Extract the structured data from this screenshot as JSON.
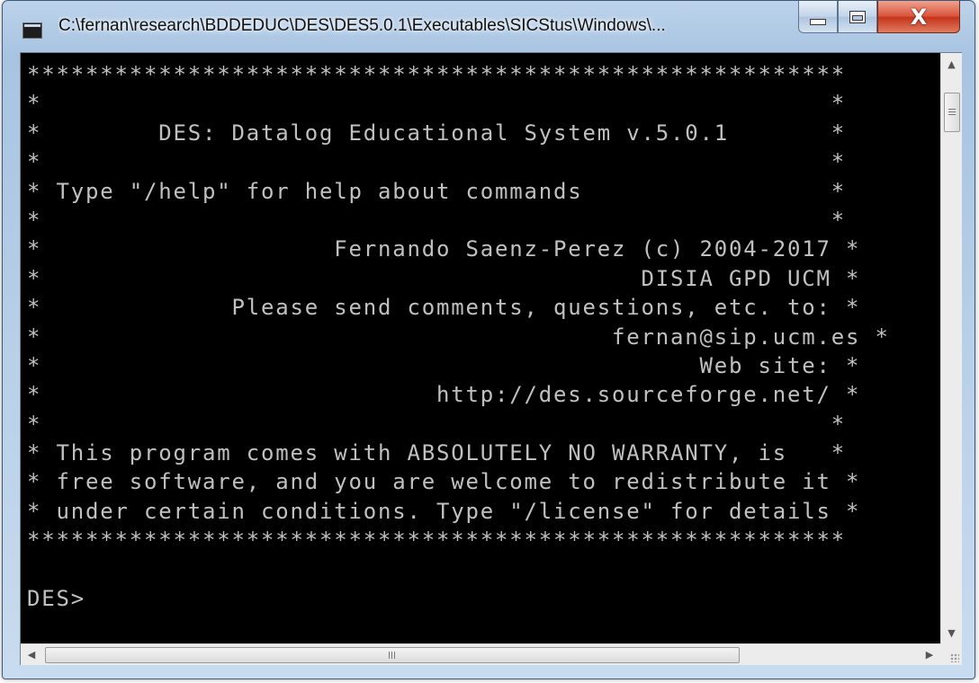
{
  "window": {
    "title": "C:\\fernan\\research\\BDDEDUC\\DES\\DES5.0.1\\Executables\\SICStus\\Windows\\...",
    "minimize_glyph": "",
    "maximize_glyph": "",
    "close_glyph": "X"
  },
  "console": {
    "lines": [
      "********************************************************",
      "*                                                      *",
      "*        DES: Datalog Educational System v.5.0.1       *",
      "*                                                      *",
      "* Type \"/help\" for help about commands                 *",
      "*                                                      *",
      "*                    Fernando Saenz-Perez (c) 2004-2017 *",
      "*                                         DISIA GPD UCM *",
      "*             Please send comments, questions, etc. to: *",
      "*                                       fernan@sip.ucm.es *",
      "*                                             Web site: *",
      "*                           http://des.sourceforge.net/ *",
      "*                                                      *",
      "* This program comes with ABSOLUTELY NO WARRANTY, is   *",
      "* free software, and you are welcome to redistribute it *",
      "* under certain conditions. Type \"/license\" for details *",
      "********************************************************",
      "",
      "DES>"
    ]
  },
  "scrollbars": {
    "vertical": {
      "up_arrow": "▲",
      "down_arrow": "▼"
    },
    "horizontal": {
      "left_arrow": "◀",
      "right_arrow": "▶",
      "thumb_grip": "III"
    }
  }
}
